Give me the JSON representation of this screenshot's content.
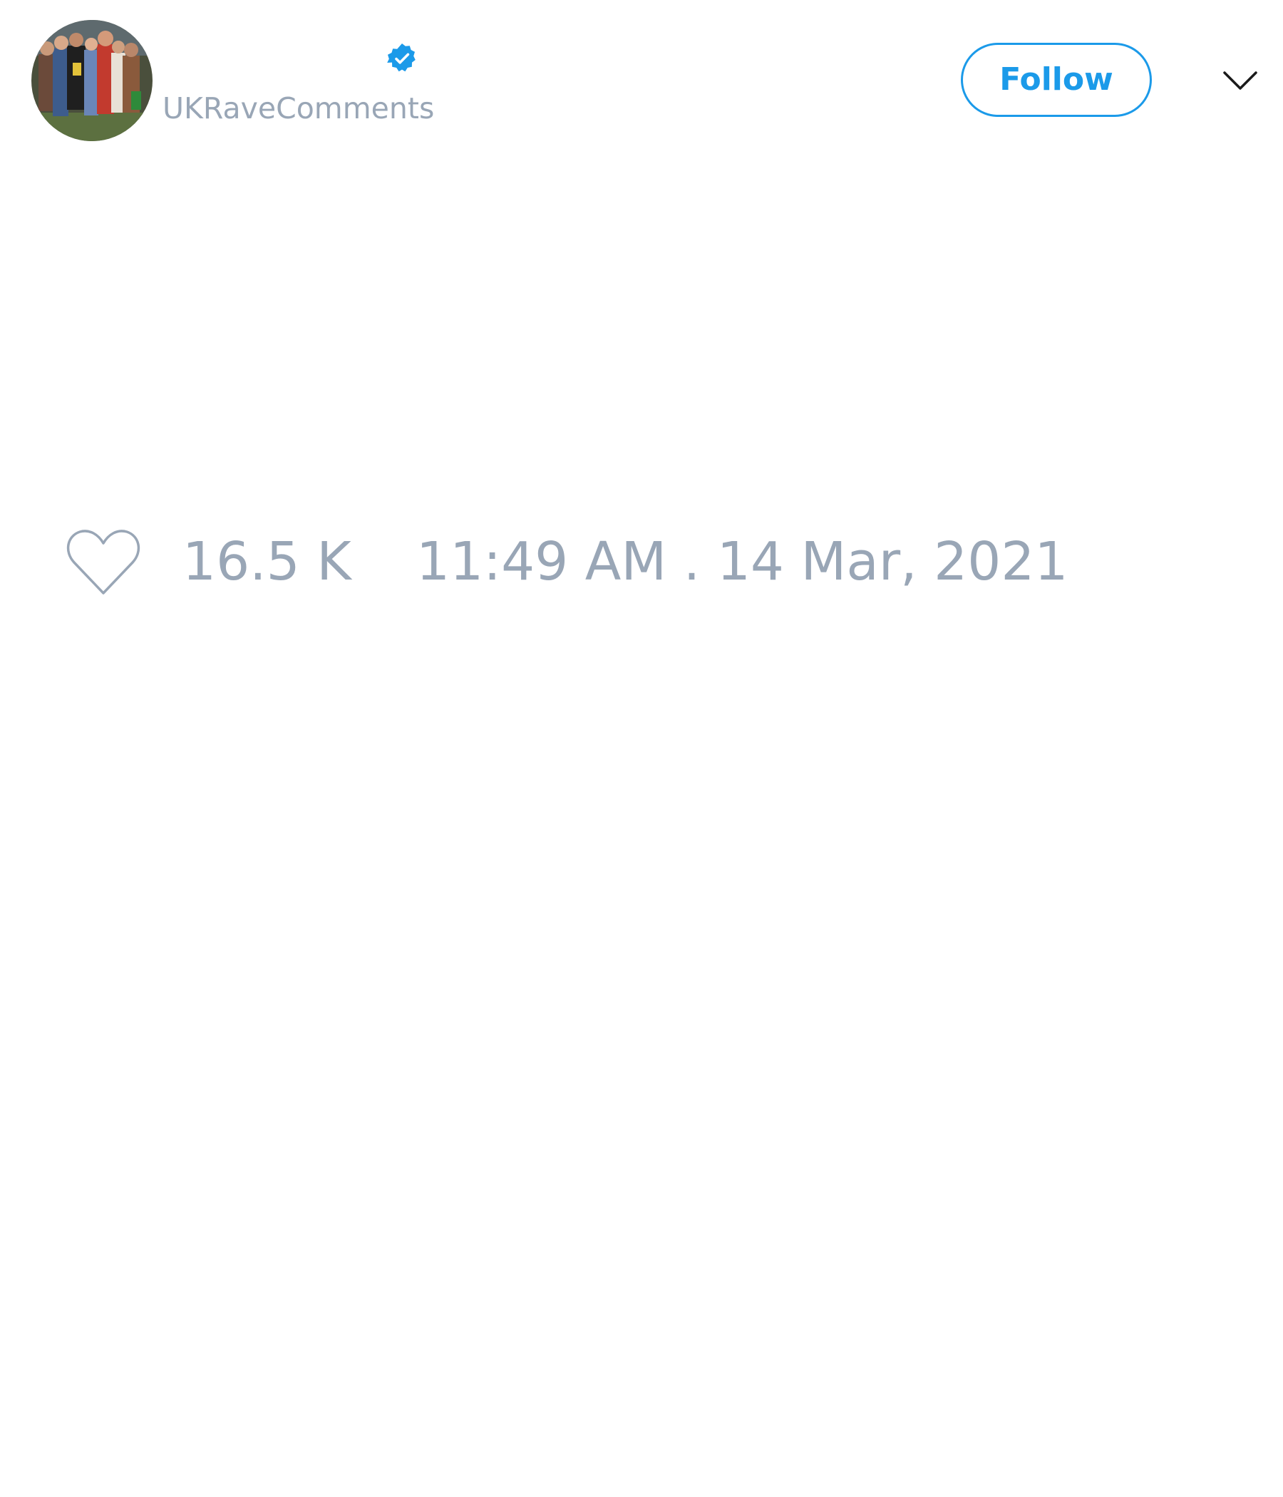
{
  "author": {
    "handle": "UKRaveComments",
    "verified": true,
    "avatar_icon": "group-photo-avatar"
  },
  "header": {
    "follow_label": "Follow",
    "more_icon": "chevron-down-icon"
  },
  "footer": {
    "like_icon": "heart-outline-icon",
    "like_count": "16.5 K",
    "timestamp": "11:49 AM . 14 Mar, 2021"
  },
  "colors": {
    "accent": "#1b9ae9",
    "muted_text": "#99a6b6",
    "background": "#ffffff"
  }
}
